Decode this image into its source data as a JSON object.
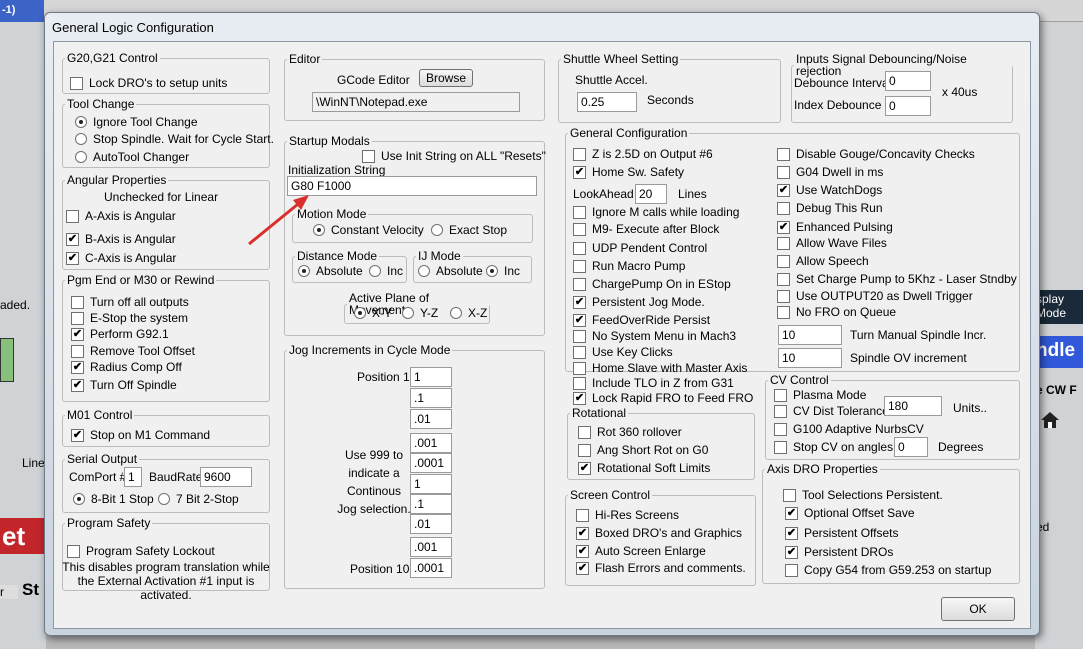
{
  "window": {
    "title": "General Logic Configuration"
  },
  "background": {
    "top_left": "-1)",
    "left_text_1": "aded.",
    "left_text_2": "Line",
    "left_text_3": "r",
    "left_text_4": "St",
    "red_text": "et",
    "right_display": [
      "splay",
      "Mode"
    ],
    "right_blue": "ndle",
    "right_text_1": "e CW F",
    "right_text_2": "ed"
  },
  "g20": {
    "title": "G20,G21 Control",
    "lock_dro": {
      "label": "Lock DRO's to setup units",
      "checked": false
    }
  },
  "tool_change": {
    "title": "Tool Change",
    "options": [
      "Ignore Tool Change",
      "Stop Spindle. Wait for Cycle Start.",
      "AutoTool Changer"
    ],
    "selected": 0
  },
  "angular": {
    "title": "Angular Properties",
    "subtitle": "Unchecked for Linear",
    "items": [
      {
        "label": "A-Axis is Angular",
        "checked": false
      },
      {
        "label": "B-Axis is Angular",
        "checked": true
      },
      {
        "label": "C-Axis is Angular",
        "checked": true
      }
    ]
  },
  "pgm_end": {
    "title": "Pgm End or M30 or Rewind",
    "items": [
      {
        "label": "Turn off all outputs",
        "checked": false
      },
      {
        "label": "E-Stop the system",
        "checked": false
      },
      {
        "label": "Perform G92.1",
        "checked": true
      },
      {
        "label": "Remove Tool Offset",
        "checked": false
      },
      {
        "label": "Radius Comp Off",
        "checked": true
      },
      {
        "label": "Turn Off Spindle",
        "checked": true
      }
    ]
  },
  "m01": {
    "title": "M01 Control",
    "stop": {
      "label": "Stop on M1 Command",
      "checked": true
    }
  },
  "serial": {
    "title": "Serial Output",
    "comport_label": "ComPort #",
    "comport_value": "1",
    "baud_label": "BaudRate",
    "baud_value": "9600",
    "options": [
      "8-Bit 1 Stop",
      "7 Bit 2-Stop"
    ],
    "selected": 0
  },
  "safety": {
    "title": "Program Safety",
    "lockout": {
      "label": "Program Safety Lockout",
      "checked": false
    },
    "desc": "This disables program translation while the External Activation #1 input is activated."
  },
  "editor": {
    "title": "Editor",
    "label": "GCode Editor",
    "browse": "Browse",
    "path": "\\WinNT\\Notepad.exe"
  },
  "startup": {
    "title": "Startup Modals",
    "use_init": {
      "label": "Use Init String on ALL  \"Resets\"",
      "checked": false
    },
    "init_label": "Initialization String",
    "init_value": "G80 F1000",
    "motion": {
      "title": "Motion Mode",
      "options": [
        "Constant Velocity",
        "Exact Stop"
      ],
      "selected": 0
    },
    "distance": {
      "title": "Distance Mode",
      "options": [
        "Absolute",
        "Inc"
      ],
      "selected": 0
    },
    "ij": {
      "title": "IJ Mode",
      "options": [
        "Absolute",
        "Inc"
      ],
      "selected": 1
    },
    "plane": {
      "title": "Active Plane of Movement",
      "options": [
        "X-Y",
        "Y-Z",
        "X-Z"
      ],
      "selected": 0
    }
  },
  "jog": {
    "title": "Jog Increments in Cycle Mode",
    "pos1": "Position 1",
    "pos10": "Position 10",
    "note": "Use 999 to indicate a Continous Jog selection.",
    "values": [
      "1",
      ".1",
      ".01",
      ".001",
      ".0001",
      "1",
      ".1",
      ".01",
      ".001",
      ".0001"
    ]
  },
  "shuttle": {
    "title": "Shuttle Wheel Setting",
    "label": "Shuttle Accel.",
    "value": "0.25",
    "unit": "Seconds"
  },
  "debounce": {
    "title": "Inputs Signal Debouncing/Noise rejection",
    "interval_label": "Debounce Interval",
    "interval_value": "0",
    "index_label": "Index Debounce",
    "index_value": "0",
    "unit": "x 40us"
  },
  "general": {
    "title": "General Configuration",
    "left": [
      {
        "label": "Z is 2.5D on Output #6",
        "checked": false
      },
      {
        "label": "Home Sw. Safety",
        "checked": true
      }
    ],
    "lookahead_label": "LookAhead",
    "lookahead_value": "20",
    "lookahead_unit": "Lines",
    "left2": [
      {
        "label": "Ignore M calls while loading",
        "checked": false
      },
      {
        "label": "M9- Execute after Block",
        "checked": false
      },
      {
        "label": "UDP Pendent Control",
        "checked": false
      },
      {
        "label": "Run Macro Pump",
        "checked": false
      },
      {
        "label": "ChargePump On in EStop",
        "checked": false
      },
      {
        "label": "Persistent Jog Mode.",
        "checked": true
      },
      {
        "label": "FeedOverRide Persist",
        "checked": true
      },
      {
        "label": "No System Menu in Mach3",
        "checked": false
      },
      {
        "label": "Use Key Clicks",
        "checked": false
      },
      {
        "label": "Home Slave with Master Axis",
        "checked": false
      },
      {
        "label": "Include TLO in Z from G31",
        "checked": false
      },
      {
        "label": "Lock Rapid FRO to Feed FRO",
        "checked": true
      }
    ],
    "right": [
      {
        "label": "Disable Gouge/Concavity Checks",
        "checked": false
      },
      {
        "label": "G04 Dwell in ms",
        "checked": false
      },
      {
        "label": "Use WatchDogs",
        "checked": true
      },
      {
        "label": "Debug This Run",
        "checked": false
      },
      {
        "label": "Enhanced Pulsing",
        "checked": true
      },
      {
        "label": "Allow Wave Files",
        "checked": false
      },
      {
        "label": "Allow Speech",
        "checked": false
      },
      {
        "label": "Set Charge Pump to 5Khz  - Laser Stndby",
        "checked": false
      },
      {
        "label": "Use OUTPUT20 as Dwell Trigger",
        "checked": false
      },
      {
        "label": "No FRO on Queue",
        "checked": false
      }
    ],
    "spindle_incr_value": "10",
    "spindle_incr_label": "Turn Manual Spindle Incr.",
    "spindle_ov_value": "10",
    "spindle_ov_label": "Spindle OV increment"
  },
  "rotational": {
    "title": "Rotational",
    "items": [
      {
        "label": "Rot 360 rollover",
        "checked": false
      },
      {
        "label": "Ang Short Rot on G0",
        "checked": false
      },
      {
        "label": "Rotational Soft Limits",
        "checked": true
      }
    ]
  },
  "cv": {
    "title": "CV Control",
    "plasma": {
      "label": "Plasma Mode",
      "checked": false
    },
    "dist": {
      "label": "CV Dist Tolerance",
      "checked": false,
      "value": "180",
      "unit": "Units.."
    },
    "g100": {
      "label": "G100 Adaptive NurbsCV",
      "checked": false
    },
    "stop": {
      "label": "Stop CV on angles >",
      "checked": false,
      "value": "0",
      "unit": "Degrees"
    }
  },
  "screen": {
    "title": "Screen Control",
    "items": [
      {
        "label": "Hi-Res Screens",
        "checked": false
      },
      {
        "label": "Boxed DRO's and Graphics",
        "checked": true
      },
      {
        "label": "Auto Screen Enlarge",
        "checked": true
      },
      {
        "label": "Flash Errors and comments.",
        "checked": true
      }
    ]
  },
  "axis_dro": {
    "title": "Axis DRO Properties",
    "items": [
      {
        "label": "Tool Selections Persistent.",
        "checked": false
      },
      {
        "label": "Optional Offset Save",
        "checked": true
      },
      {
        "label": "Persistent Offsets",
        "checked": true
      },
      {
        "label": "Persistent DROs",
        "checked": true
      },
      {
        "label": "Copy G54 from G59.253 on startup",
        "checked": false
      }
    ]
  },
  "ok": "OK",
  "colors": {
    "arrow": "#d9302b",
    "title_blue": "#3b63c8",
    "red_panel": "#c2262b"
  }
}
